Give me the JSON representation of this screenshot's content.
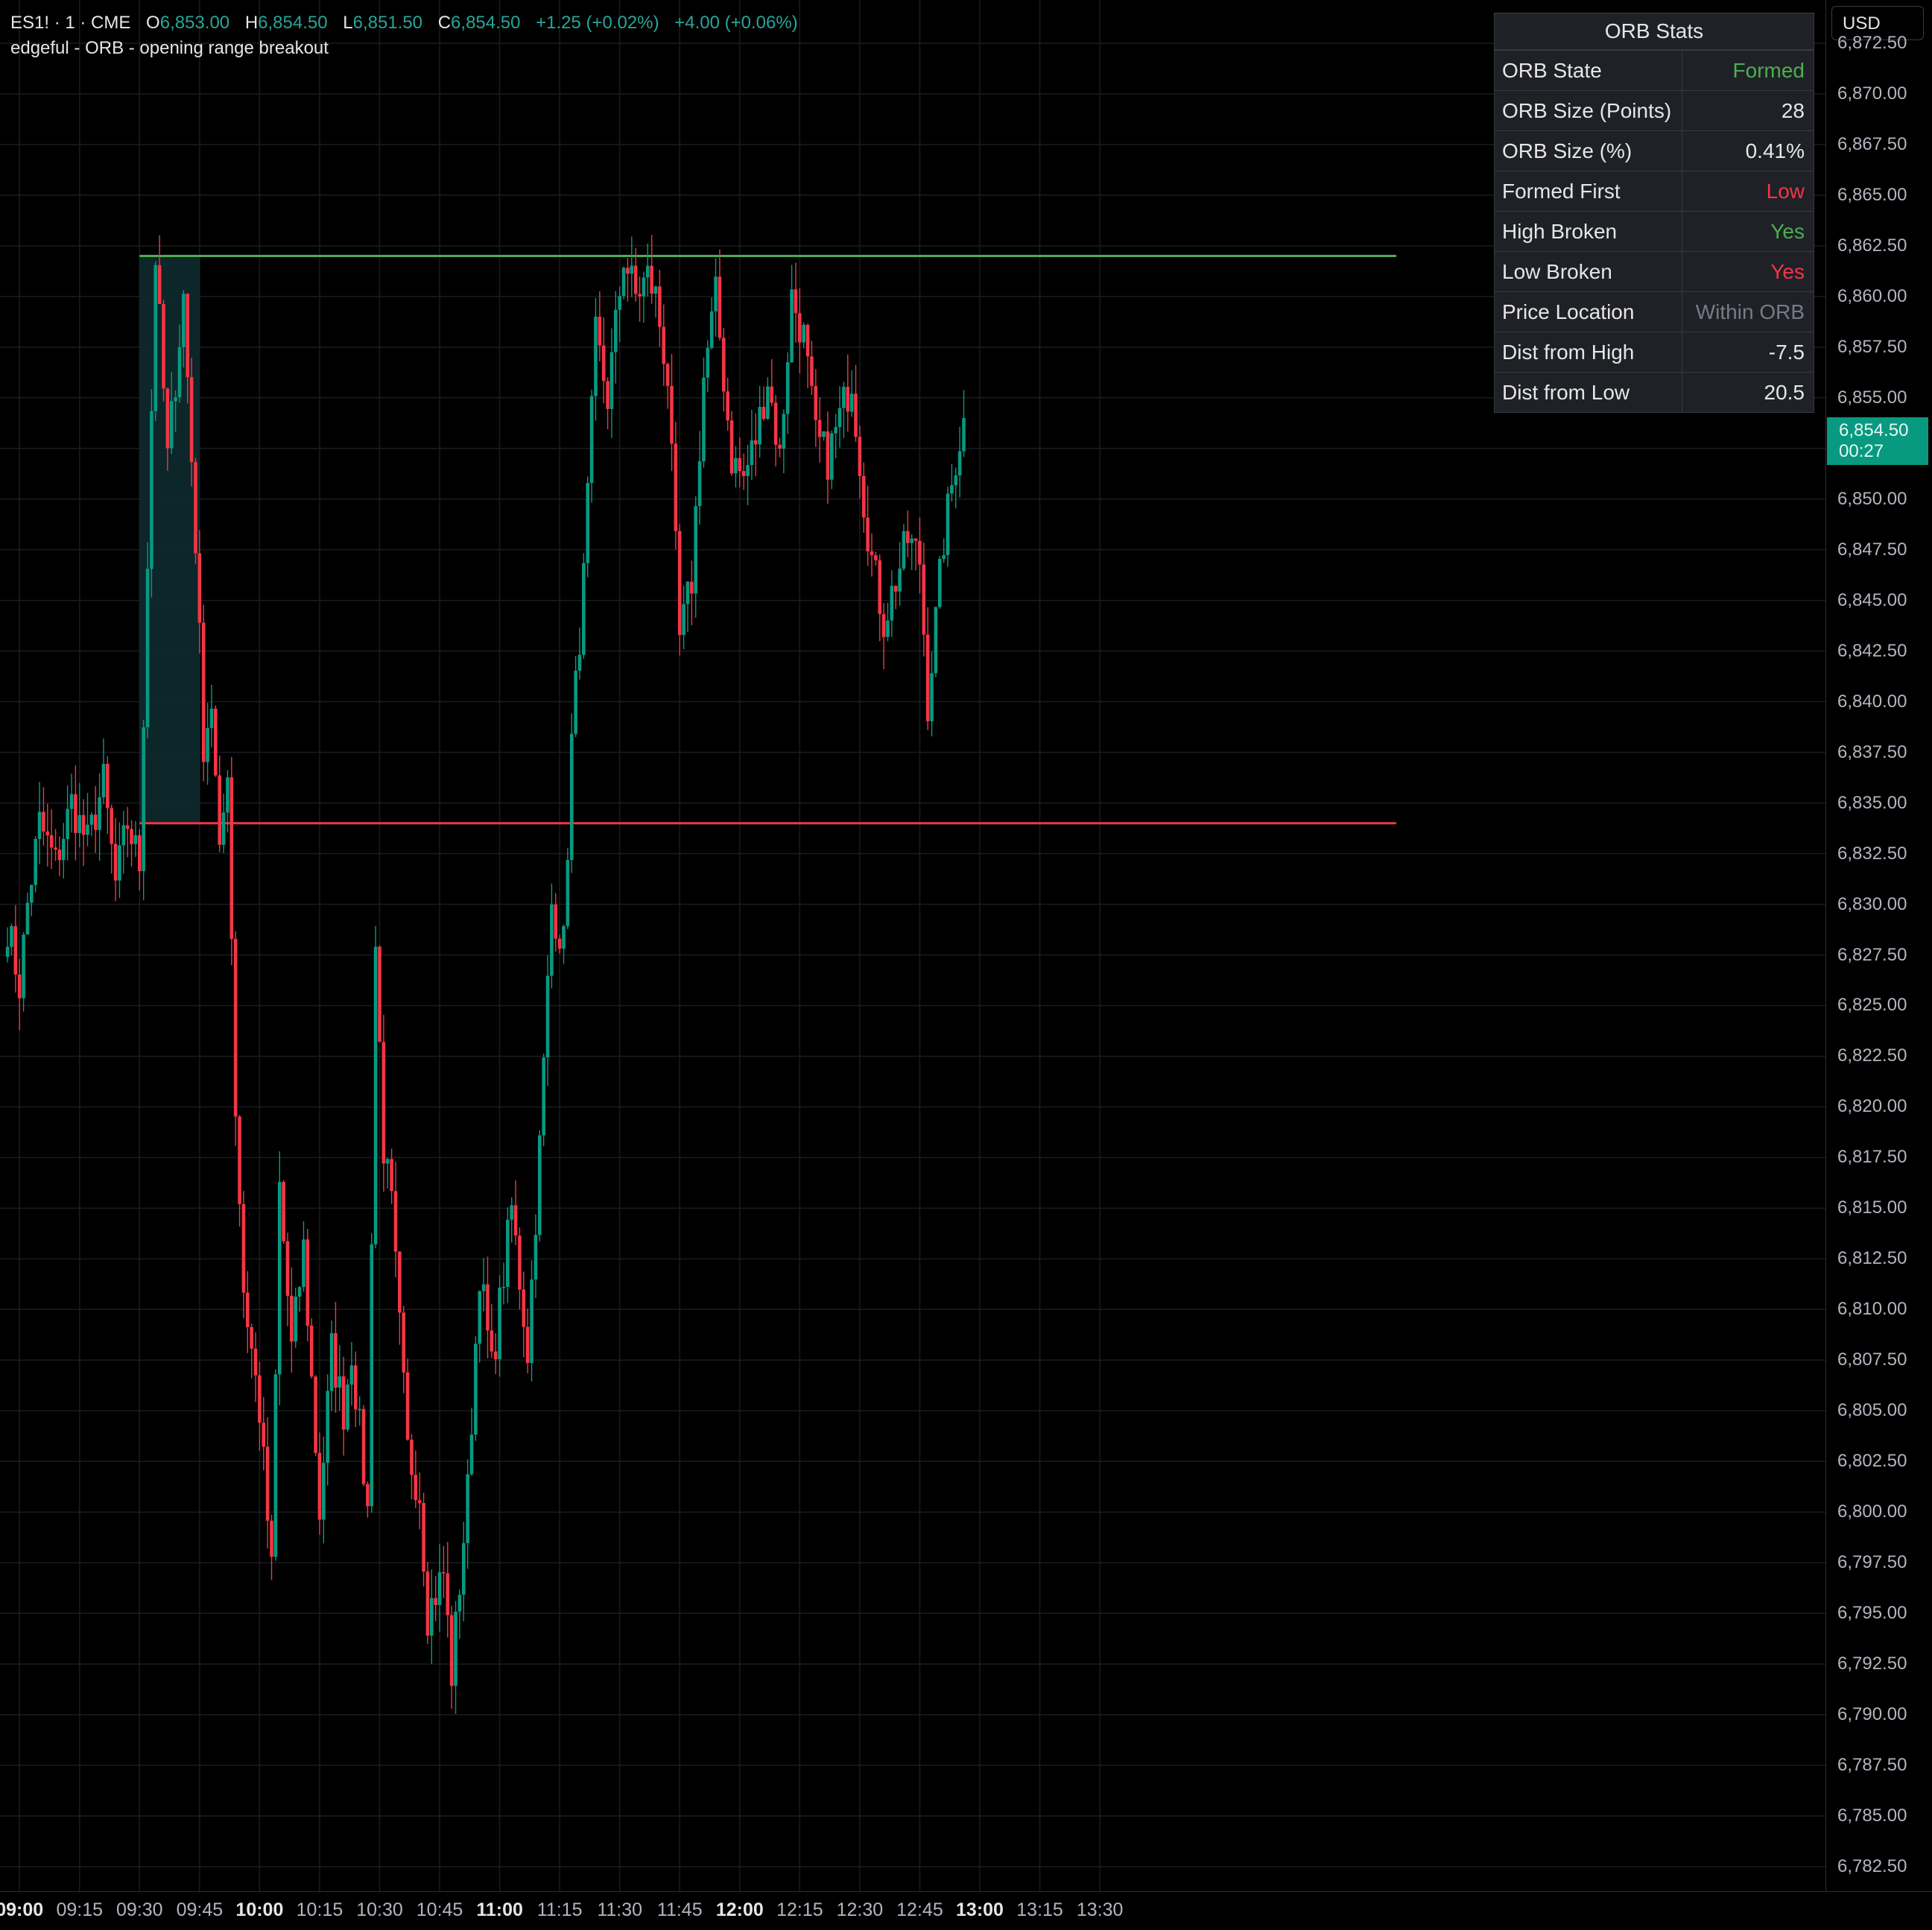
{
  "legend": {
    "symbol": "ES1! · 1 · CME",
    "open_key": "O",
    "open": "6,853.00",
    "high_key": "H",
    "high": "6,854.50",
    "low_key": "L",
    "low": "6,851.50",
    "close_key": "C",
    "close": "6,854.50",
    "change": "+1.25 (+0.02%)",
    "change2": "+4.00 (+0.06%)",
    "indicator": "edgeful - ORB - opening range breakout"
  },
  "stats": {
    "title": "ORB Stats",
    "rows": [
      {
        "label": "ORB State",
        "value": "Formed",
        "color": "#4caf50"
      },
      {
        "label": "ORB Size (Points)",
        "value": "28",
        "color": "#e6e6e6"
      },
      {
        "label": "ORB Size (%)",
        "value": "0.41%",
        "color": "#e6e6e6"
      },
      {
        "label": "Formed First",
        "value": "Low",
        "color": "#f23645"
      },
      {
        "label": "High Broken",
        "value": "Yes",
        "color": "#4caf50"
      },
      {
        "label": "Low Broken",
        "value": "Yes",
        "color": "#f23645"
      },
      {
        "label": "Price Location",
        "value": "Within ORB",
        "color": "#787b86"
      },
      {
        "label": "Dist from High",
        "value": "-7.5",
        "color": "#e6e6e6"
      },
      {
        "label": "Dist from Low",
        "value": "20.5",
        "color": "#e6e6e6"
      }
    ]
  },
  "price_axis": {
    "currency": "USD",
    "labels": [
      "6,872.50",
      "6,870.00",
      "6,867.50",
      "6,865.00",
      "6,862.50",
      "6,860.00",
      "6,857.50",
      "6,855.00",
      "6,852.50",
      "6,850.00",
      "6,847.50",
      "6,845.00",
      "6,842.50",
      "6,840.00",
      "6,837.50",
      "6,835.00",
      "6,832.50",
      "6,830.00",
      "6,827.50",
      "6,825.00",
      "6,822.50",
      "6,820.00",
      "6,817.50",
      "6,815.00",
      "6,812.50",
      "6,810.00",
      "6,807.50",
      "6,805.00",
      "6,802.50",
      "6,800.00",
      "6,797.50",
      "6,795.00",
      "6,792.50",
      "6,790.00",
      "6,787.50",
      "6,785.00",
      "6,782.50"
    ],
    "last_price": "6,854.50",
    "countdown": "00:27"
  },
  "time_axis": {
    "labels": [
      {
        "text": "09:00",
        "bold": true
      },
      {
        "text": "09:15",
        "bold": false
      },
      {
        "text": "09:30",
        "bold": false
      },
      {
        "text": "09:45",
        "bold": false
      },
      {
        "text": "10:00",
        "bold": true
      },
      {
        "text": "10:15",
        "bold": false
      },
      {
        "text": "10:30",
        "bold": false
      },
      {
        "text": "10:45",
        "bold": false
      },
      {
        "text": "11:00",
        "bold": true
      },
      {
        "text": "11:15",
        "bold": false
      },
      {
        "text": "11:30",
        "bold": false
      },
      {
        "text": "11:45",
        "bold": false
      },
      {
        "text": "12:00",
        "bold": true
      },
      {
        "text": "12:15",
        "bold": false
      },
      {
        "text": "12:30",
        "bold": false
      },
      {
        "text": "12:45",
        "bold": false
      },
      {
        "text": "13:00",
        "bold": true
      },
      {
        "text": "13:15",
        "bold": false
      },
      {
        "text": "13:30",
        "bold": false
      }
    ]
  },
  "chart_data": {
    "type": "candlestick",
    "interval_minutes": 1,
    "start_time": "08:57",
    "ylim": [
      6781.5,
      6874
    ],
    "orb": {
      "start": "09:30",
      "end": "09:45",
      "high": 6862,
      "low": 6834
    },
    "colors": {
      "up": "#089981",
      "down": "#f23645",
      "orb_high": "#4caf50",
      "orb_low": "#f23645",
      "orb_box": "#0e2a2e"
    },
    "path": [
      [
        0,
        6829
      ],
      [
        3,
        6826
      ],
      [
        5,
        6830
      ],
      [
        8,
        6834
      ],
      [
        12,
        6832
      ],
      [
        16,
        6835
      ],
      [
        20,
        6833
      ],
      [
        24,
        6836
      ],
      [
        27,
        6831
      ],
      [
        30,
        6834
      ],
      [
        33,
        6832
      ],
      [
        37,
        6862
      ],
      [
        40,
        6852
      ],
      [
        44,
        6860
      ],
      [
        47,
        6848
      ],
      [
        49,
        6838
      ],
      [
        51,
        6840
      ],
      [
        53,
        6832
      ],
      [
        55,
        6837
      ],
      [
        57,
        6820
      ],
      [
        59,
        6811
      ],
      [
        63,
        6805
      ],
      [
        66,
        6797
      ],
      [
        68,
        6816
      ],
      [
        71,
        6808
      ],
      [
        74,
        6813
      ],
      [
        78,
        6800
      ],
      [
        81,
        6808
      ],
      [
        84,
        6805
      ],
      [
        86,
        6808
      ],
      [
        90,
        6800
      ],
      [
        92,
        6828
      ],
      [
        94,
        6818
      ],
      [
        96,
        6815
      ],
      [
        100,
        6803
      ],
      [
        103,
        6801
      ],
      [
        105,
        6795
      ],
      [
        109,
        6797
      ],
      [
        111,
        6792
      ],
      [
        115,
        6801
      ],
      [
        118,
        6812
      ],
      [
        121,
        6807
      ],
      [
        126,
        6815
      ],
      [
        130,
        6808
      ],
      [
        133,
        6818
      ],
      [
        136,
        6830
      ],
      [
        139,
        6828
      ],
      [
        141,
        6838
      ],
      [
        144,
        6846
      ],
      [
        147,
        6858
      ],
      [
        150,
        6855
      ],
      [
        154,
        6862
      ],
      [
        157,
        6860
      ],
      [
        160,
        6861
      ],
      [
        162,
        6860
      ],
      [
        165,
        6856
      ],
      [
        168,
        6843
      ],
      [
        171,
        6846
      ],
      [
        174,
        6856
      ],
      [
        177,
        6860
      ],
      [
        181,
        6852
      ],
      [
        184,
        6851
      ],
      [
        187,
        6853
      ],
      [
        190,
        6856
      ],
      [
        193,
        6852
      ],
      [
        196,
        6860
      ],
      [
        199,
        6858
      ],
      [
        202,
        6853
      ],
      [
        205,
        6852
      ],
      [
        208,
        6854
      ],
      [
        211,
        6856
      ],
      [
        214,
        6850
      ],
      [
        216,
        6847
      ],
      [
        219,
        6844
      ],
      [
        222,
        6846
      ],
      [
        225,
        6848
      ],
      [
        228,
        6847
      ],
      [
        230,
        6840
      ],
      [
        234,
        6848
      ],
      [
        237,
        6852
      ],
      [
        239,
        6854
      ]
    ]
  }
}
